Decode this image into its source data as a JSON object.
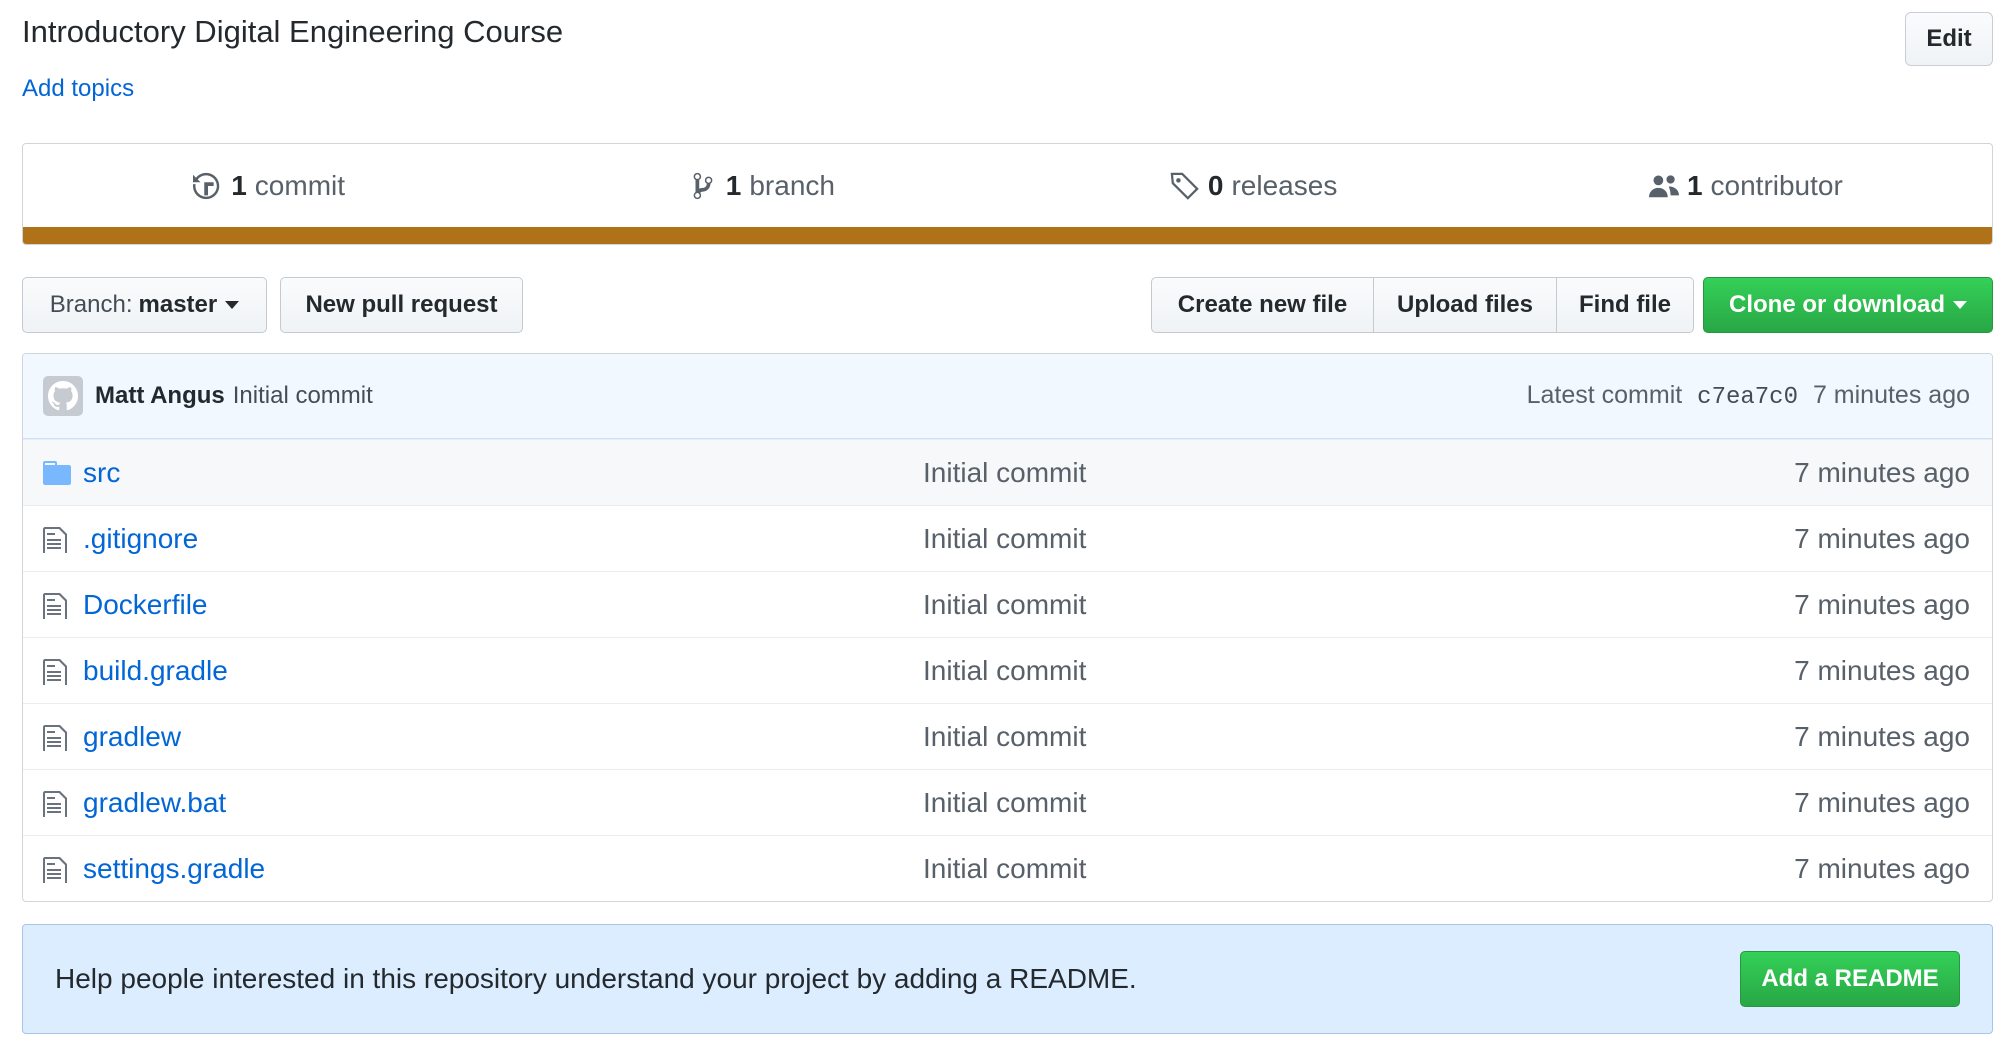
{
  "repo": {
    "description": "Introductory Digital Engineering Course",
    "add_topics": "Add topics",
    "edit_label": "Edit"
  },
  "summary": {
    "commits": {
      "count": "1",
      "label": "commit",
      "icon": "history-icon"
    },
    "branches": {
      "count": "1",
      "label": "branch",
      "icon": "branch-icon"
    },
    "releases": {
      "count": "0",
      "label": "releases",
      "icon": "tag-icon"
    },
    "contributors": {
      "count": "1",
      "label": "contributor",
      "icon": "people-icon"
    },
    "language_color": "#b07219"
  },
  "toolbar": {
    "branch_label": "Branch:",
    "branch_value": "master",
    "new_pr": "New pull request",
    "create_file": "Create new file",
    "upload_files": "Upload files",
    "find_file": "Find file",
    "clone": "Clone or download"
  },
  "latest_commit": {
    "author": "Matt Angus",
    "message": "Initial commit",
    "prefix": "Latest commit",
    "sha": "c7ea7c0",
    "age": "7 minutes ago"
  },
  "files": [
    {
      "name": "src",
      "type": "dir",
      "message": "Initial commit",
      "age": "7 minutes ago"
    },
    {
      "name": ".gitignore",
      "type": "file",
      "message": "Initial commit",
      "age": "7 minutes ago"
    },
    {
      "name": "Dockerfile",
      "type": "file",
      "message": "Initial commit",
      "age": "7 minutes ago"
    },
    {
      "name": "build.gradle",
      "type": "file",
      "message": "Initial commit",
      "age": "7 minutes ago"
    },
    {
      "name": "gradlew",
      "type": "file",
      "message": "Initial commit",
      "age": "7 minutes ago"
    },
    {
      "name": "gradlew.bat",
      "type": "file",
      "message": "Initial commit",
      "age": "7 minutes ago"
    },
    {
      "name": "settings.gradle",
      "type": "file",
      "message": "Initial commit",
      "age": "7 minutes ago"
    }
  ],
  "readme_prompt": {
    "text": "Help people interested in this repository understand your project by adding a README.",
    "button": "Add a README"
  },
  "colors": {
    "link": "#0366d6",
    "primary_button": "#28a745",
    "folder_icon": "#79b8ff"
  }
}
